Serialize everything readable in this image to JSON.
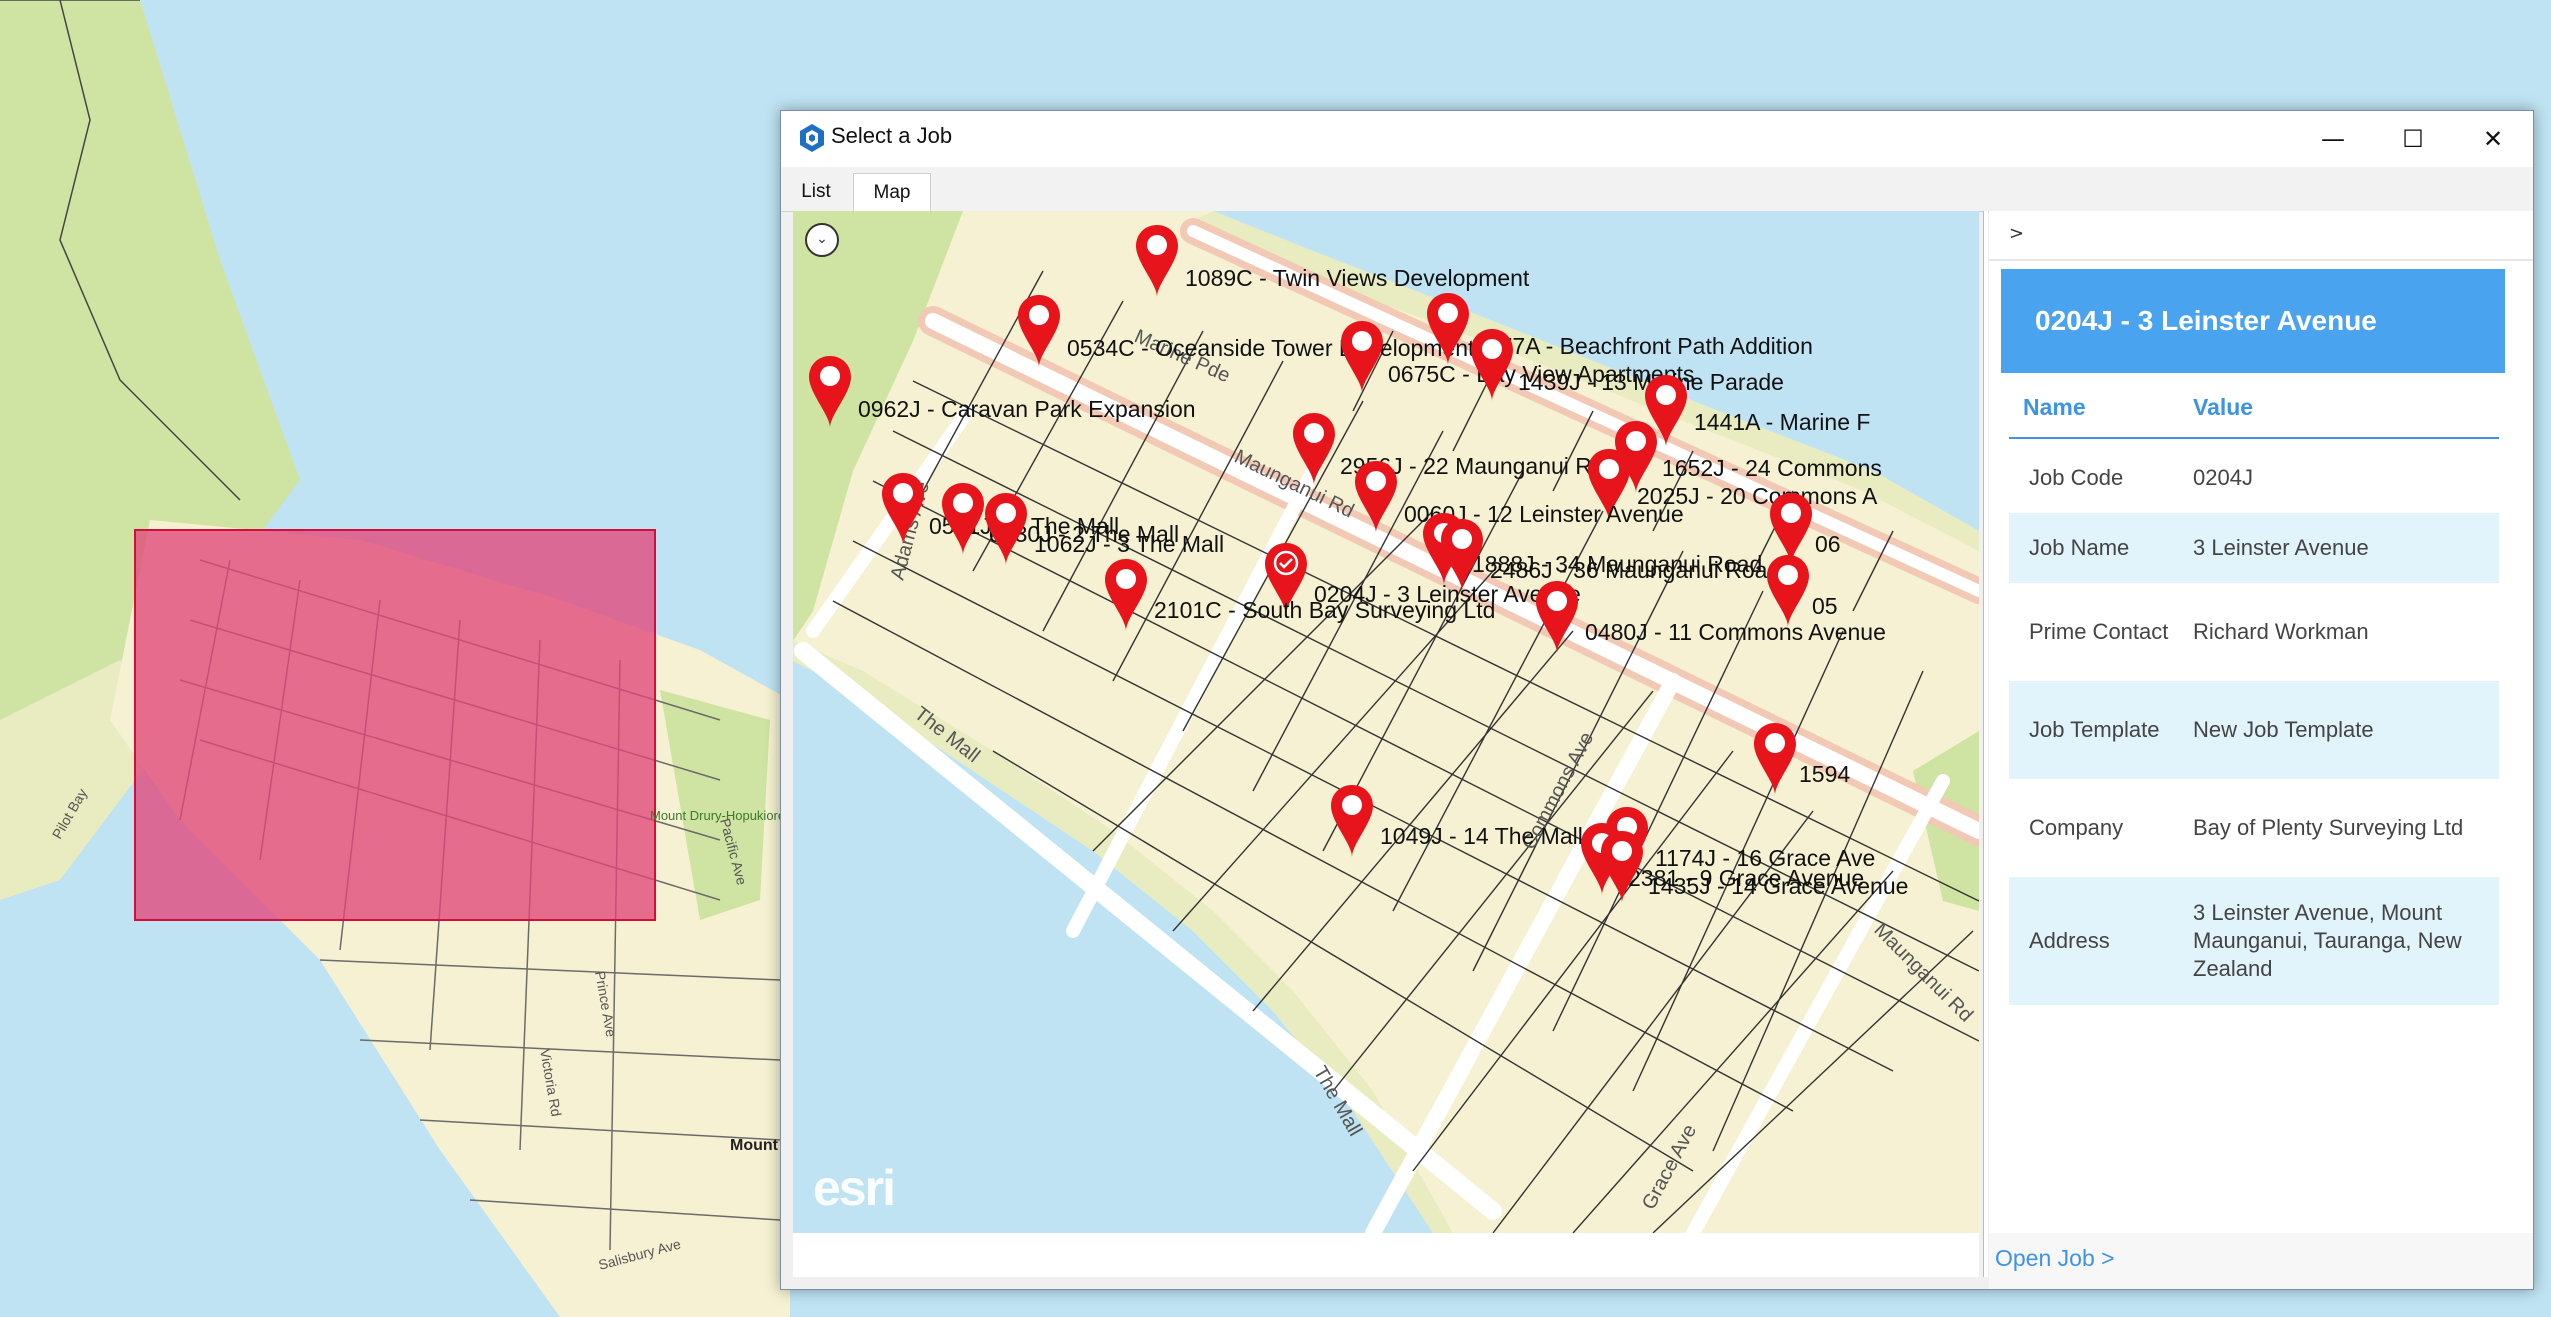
{
  "window": {
    "title": "Select a Job",
    "minimize_glyph": "—",
    "maximize_glyph": "☐",
    "close_glyph": "✕"
  },
  "tabs": [
    {
      "label": "List",
      "active": false
    },
    {
      "label": "Map",
      "active": true
    }
  ],
  "background_map": {
    "street_labels": [
      "Prince Ave",
      "Victoria Rd",
      "Salisbury Ave",
      "Pacific Ave",
      "Maunganui Rd",
      "Adams Ave",
      "Commons Ave",
      "The Mall",
      "Marine Pde",
      "Mount Drury-Hopukiore Park",
      "Mount Maunganui",
      "Pilot Bay"
    ],
    "selection_color": "#e2467a"
  },
  "map": {
    "collapse_glyph": "⌄",
    "watermark": "esri",
    "street_labels": [
      "Adams Ave",
      "Maunganui Rd",
      "The Mall",
      "Commons Ave",
      "Grace Ave",
      "Marine Pde",
      "The Mall",
      "Maunganui Rd"
    ],
    "pins": [
      {
        "label": "1089C - Twin Views Development",
        "selected": false
      },
      {
        "label": "0534C - Oceanside Tower Development",
        "selected": false
      },
      {
        "label": "1777A - Beachfront Path Addition",
        "selected": false
      },
      {
        "label": "0675C - Bay View Apartments",
        "selected": false
      },
      {
        "label": "1439J - 13 Marine Parade",
        "selected": false
      },
      {
        "label": "0962J - Caravan Park Expansion",
        "selected": false
      },
      {
        "label": "1441A - Marine F",
        "selected": false
      },
      {
        "label": "2956J - 22 Maunganui Road",
        "selected": false
      },
      {
        "label": "1652J - 24 Commons",
        "selected": false
      },
      {
        "label": "2025J - 20 Commons A",
        "selected": false
      },
      {
        "label": "0060J - 12 Leinster Avenue",
        "selected": false
      },
      {
        "label": "0541J - 1 The Mall",
        "selected": false
      },
      {
        "label": "0830J - 2 The Mall",
        "selected": false
      },
      {
        "label": "1062J - 3 The Mall",
        "selected": false
      },
      {
        "label": "1888J - 34 Maunganui Road",
        "selected": false
      },
      {
        "label": "2486J - 36 Maunganui Road",
        "selected": false
      },
      {
        "label": "06",
        "selected": false
      },
      {
        "label": "0204J - 3 Leinster Avenue",
        "selected": true
      },
      {
        "label": "2101C - South Bay Surveying Ltd",
        "selected": false
      },
      {
        "label": "05",
        "selected": false
      },
      {
        "label": "0480J - 11 Commons Avenue",
        "selected": false
      },
      {
        "label": "1594",
        "selected": false
      },
      {
        "label": "1049J - 14 The Mall",
        "selected": false
      },
      {
        "label": "1174J - 16 Grace Ave",
        "selected": false
      },
      {
        "label": "2381 - 9 Grace Avenue",
        "selected": false
      },
      {
        "label": "1435J - 14 Grace Avenue",
        "selected": false
      }
    ]
  },
  "details": {
    "toggle_glyph": ">",
    "header": "0204J - 3 Leinster Avenue",
    "col_name": "Name",
    "col_value": "Value",
    "rows": [
      {
        "name": "Job Code",
        "value": "0204J"
      },
      {
        "name": "Job Name",
        "value": "3 Leinster Avenue"
      },
      {
        "name": "Prime Contact",
        "value": "Richard Workman"
      },
      {
        "name": "Job Template",
        "value": "New Job Template"
      },
      {
        "name": "Company",
        "value": "Bay of Plenty Surveying Ltd"
      },
      {
        "name": "Address",
        "value": "3 Leinster Avenue, Mount Maunganui, Tauranga, New Zealand"
      }
    ],
    "open_job_label": "Open Job >"
  },
  "colors": {
    "accent": "#4aa3ef",
    "pin": "#e8141c",
    "row_alt": "#e2f4fb",
    "map_land": "#f5f1d2",
    "water": "#bfe3f3",
    "park": "#cfe3a2"
  }
}
